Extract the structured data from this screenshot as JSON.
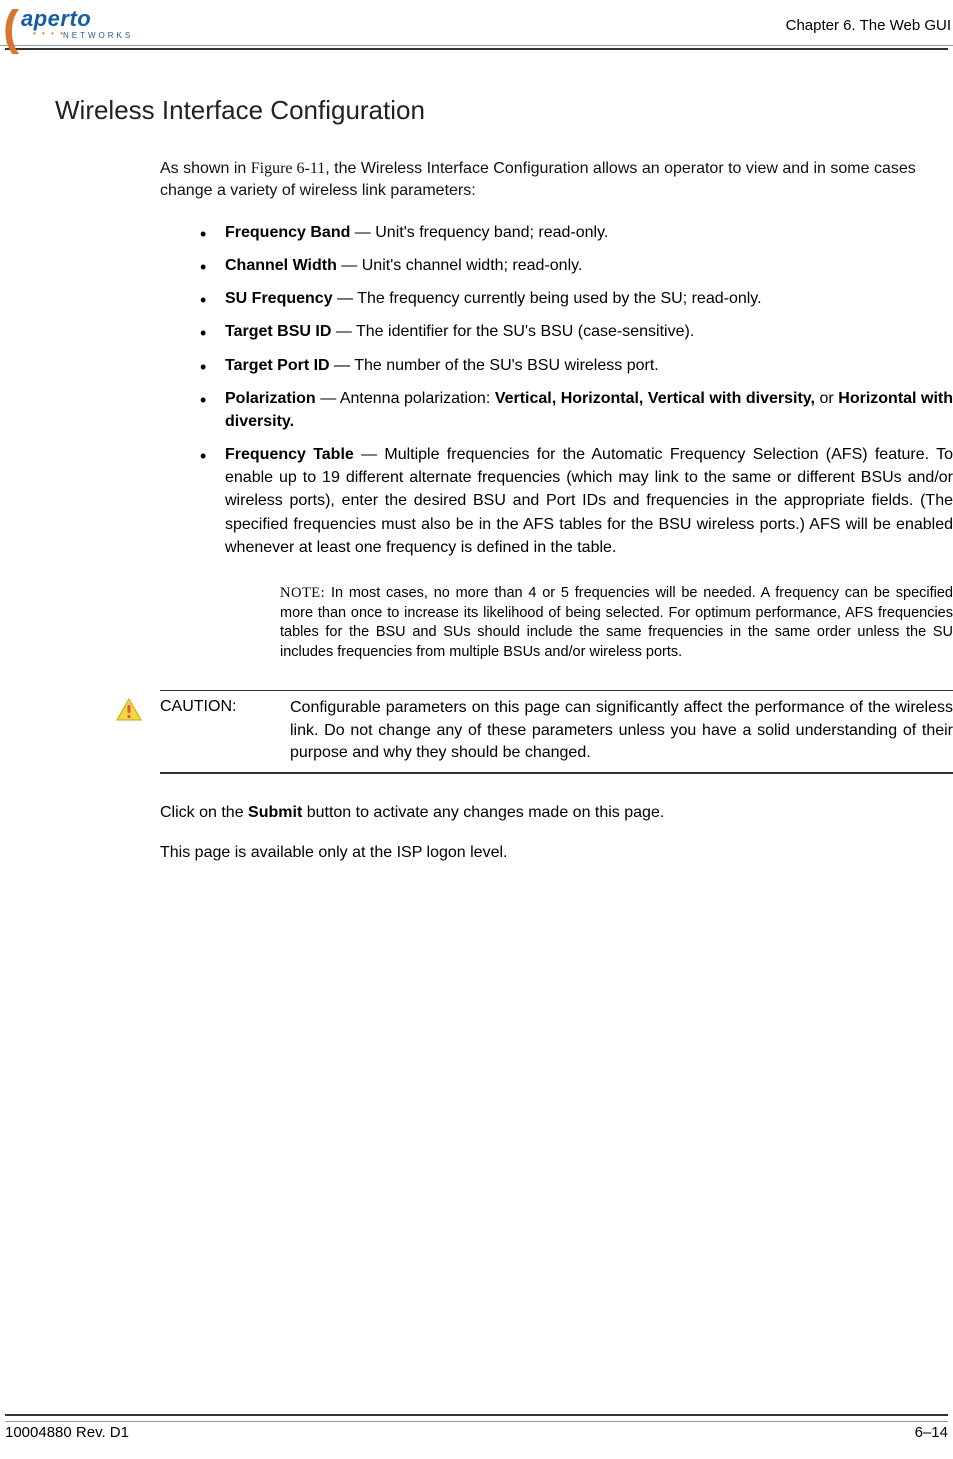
{
  "logo": {
    "brand_main": "aperto",
    "brand_sub": "NETWORKS"
  },
  "header": {
    "chapter_label": "Chapter 6.",
    "chapter_title": "The Web GUI"
  },
  "section": {
    "title": "Wireless Interface Configuration"
  },
  "intro": {
    "prefix": "As shown in ",
    "figure_ref": "Figure 6-11",
    "suffix": ", the Wireless Interface Configuration allows an operator to view and in some cases change a variety of wireless link parameters:"
  },
  "params": [
    {
      "name": "Frequency Band",
      "desc": " — Unit's frequency band; read-only."
    },
    {
      "name": "Channel Width",
      "desc": " — Unit's channel width; read-only."
    },
    {
      "name": "SU Frequency",
      "desc": " — The frequency currently being used by the SU; read-only."
    },
    {
      "name": "Target BSU ID",
      "desc": " — The identifier for the SU's BSU (case-sensitive)."
    },
    {
      "name": "Target Port ID",
      "desc": " — The number of the SU's BSU wireless port."
    },
    {
      "name": "Polarization",
      "desc_pre": " — Antenna polarization: ",
      "opts": "Vertical, Horizontal, Vertical with diversity,",
      "desc_mid": " or ",
      "opts2": "Horizontal with diversity."
    },
    {
      "name": "Frequency Table",
      "desc": " — Multiple frequencies for the Automatic Frequency Selection (AFS) feature. To enable up to 19 different alternate frequencies (which may link to the same or different BSUs and/or wireless ports), enter the desired BSU and Port IDs and frequencies in the appropriate fields. (The specified frequencies must also be in the AFS tables for the BSU wireless ports.) AFS will be enabled whenever at least one frequency is defined in the table."
    }
  ],
  "note": {
    "prefix": "NOTE:",
    "text": "  In most cases, no more than 4 or 5 frequencies will be needed. A frequency can be specified more than once to increase its likelihood of being selected. For optimum performance, AFS frequencies tables for the BSU and SUs should include the same frequencies in the same order unless the SU includes frequencies from multiple BSUs and/or wireless ports."
  },
  "caution": {
    "label": "CAUTION:",
    "text": "Configurable parameters on this page can significantly affect the performance of the wireless link. Do not change any of these parameters unless you have a solid understanding of their purpose and why they should be changed."
  },
  "submit_line": {
    "pre": "Click on the ",
    "btn": "Submit",
    "post": " button to activate any changes made on this page."
  },
  "availability": "This page is available only at the ISP logon level.",
  "footer": {
    "doc_id": "10004880 Rev. D1",
    "page_num": "6–14"
  }
}
